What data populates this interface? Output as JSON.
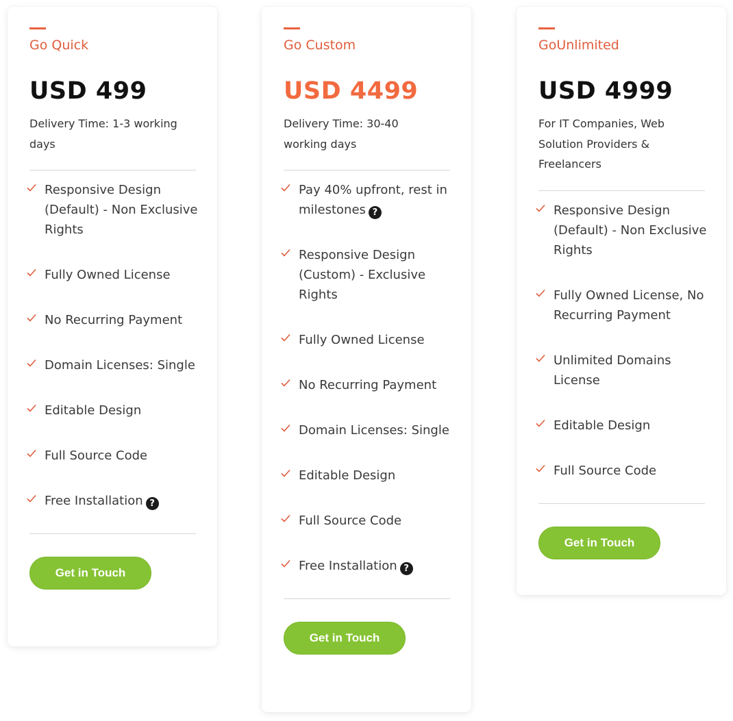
{
  "colors": {
    "accent": "#e8623f",
    "price_highlight": "#f26a3f",
    "cta_green": "#86c334",
    "check": "#e05d3c"
  },
  "plans": [
    {
      "name": "Go Quick",
      "price": "USD 499",
      "description": "Delivery Time: 1-3 working days",
      "features": [
        {
          "text": "Responsive Design (Default) - Non Exclusive Rights",
          "help": false
        },
        {
          "text": "Fully Owned License",
          "help": false
        },
        {
          "text": "No Recurring Payment",
          "help": false
        },
        {
          "text": "Domain Licenses: Single",
          "help": false
        },
        {
          "text": "Editable Design",
          "help": false
        },
        {
          "text": "Full Source Code",
          "help": false
        },
        {
          "text": "Free Installation",
          "help": true
        }
      ],
      "cta": "Get in Touch"
    },
    {
      "name": "Go Custom",
      "price": "USD 4499",
      "description": "Delivery Time: 30-40 working days",
      "features": [
        {
          "text": "Pay 40% upfront, rest in milestones",
          "help": true
        },
        {
          "text": "Responsive Design (Custom) - Exclusive Rights",
          "help": false
        },
        {
          "text": "Fully Owned License",
          "help": false
        },
        {
          "text": "No Recurring Payment",
          "help": false
        },
        {
          "text": "Domain Licenses: Single",
          "help": false
        },
        {
          "text": "Editable Design",
          "help": false
        },
        {
          "text": "Full Source Code",
          "help": false
        },
        {
          "text": "Free Installation",
          "help": true
        }
      ],
      "cta": "Get in Touch"
    },
    {
      "name": "GoUnlimited",
      "price": "USD 4999",
      "description": "For IT Companies, Web Solution Providers & Freelancers",
      "features": [
        {
          "text": "Responsive Design (Default) - Non Exclusive Rights",
          "help": false
        },
        {
          "text": "Fully Owned License, No Recurring Payment",
          "help": false
        },
        {
          "text": "Unlimited Domains License",
          "help": false
        },
        {
          "text": "Editable Design",
          "help": false
        },
        {
          "text": "Full Source Code",
          "help": false
        }
      ],
      "cta": "Get in Touch"
    }
  ],
  "help_glyph": "?"
}
